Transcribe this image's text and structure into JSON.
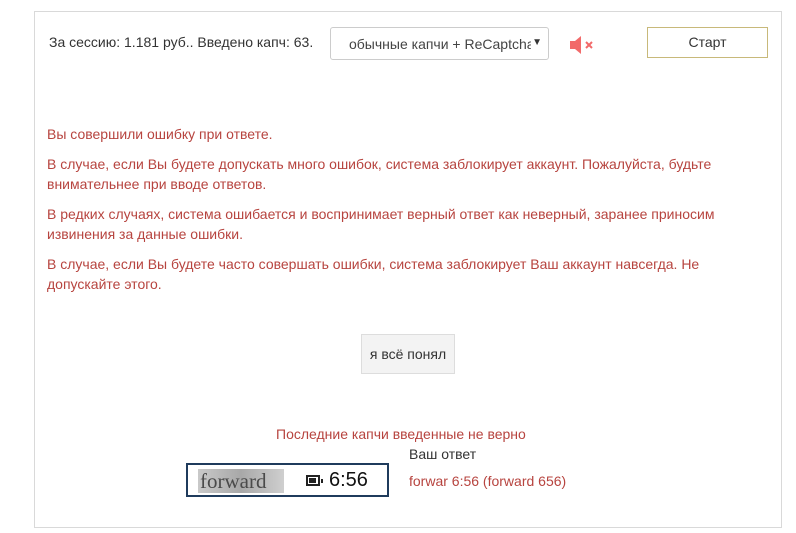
{
  "header": {
    "session_text": "За сессию: 1.181 руб.. Введено капч: 63.",
    "mode_select_value": "обычные капчи + ReCaptcha",
    "start_label": "Старт",
    "speaker_icon": "speaker-muted-icon",
    "speaker_color": "#f26a6a"
  },
  "messages": {
    "m1": "Вы совершили ошибку при ответе.",
    "m2": "В случае, если Вы будете допускать много ошибок, система заблокирует аккаунт. Пожалуйста, будьте внимательнее при вводе ответов.",
    "m3": "В редких случаях, система ошибается и воспринимает верный ответ как неверный, заранее приносим извинения за данные ошибки.",
    "m4": "В случае, если Вы будете часто совершать ошибки, система заблокирует Ваш аккаунт навсегда. Не допускайте этого."
  },
  "ack_button_label": "я всё понял",
  "last_errors": {
    "title": "Последние капчи введенные не верно",
    "answer_header": "Ваш ответ",
    "captcha_word": "forward",
    "captcha_time": "6:56",
    "answer_value": "forwar 6:56 (forward 656)"
  },
  "colors": {
    "error_text": "#b7443f",
    "start_border": "#c8b97a"
  }
}
